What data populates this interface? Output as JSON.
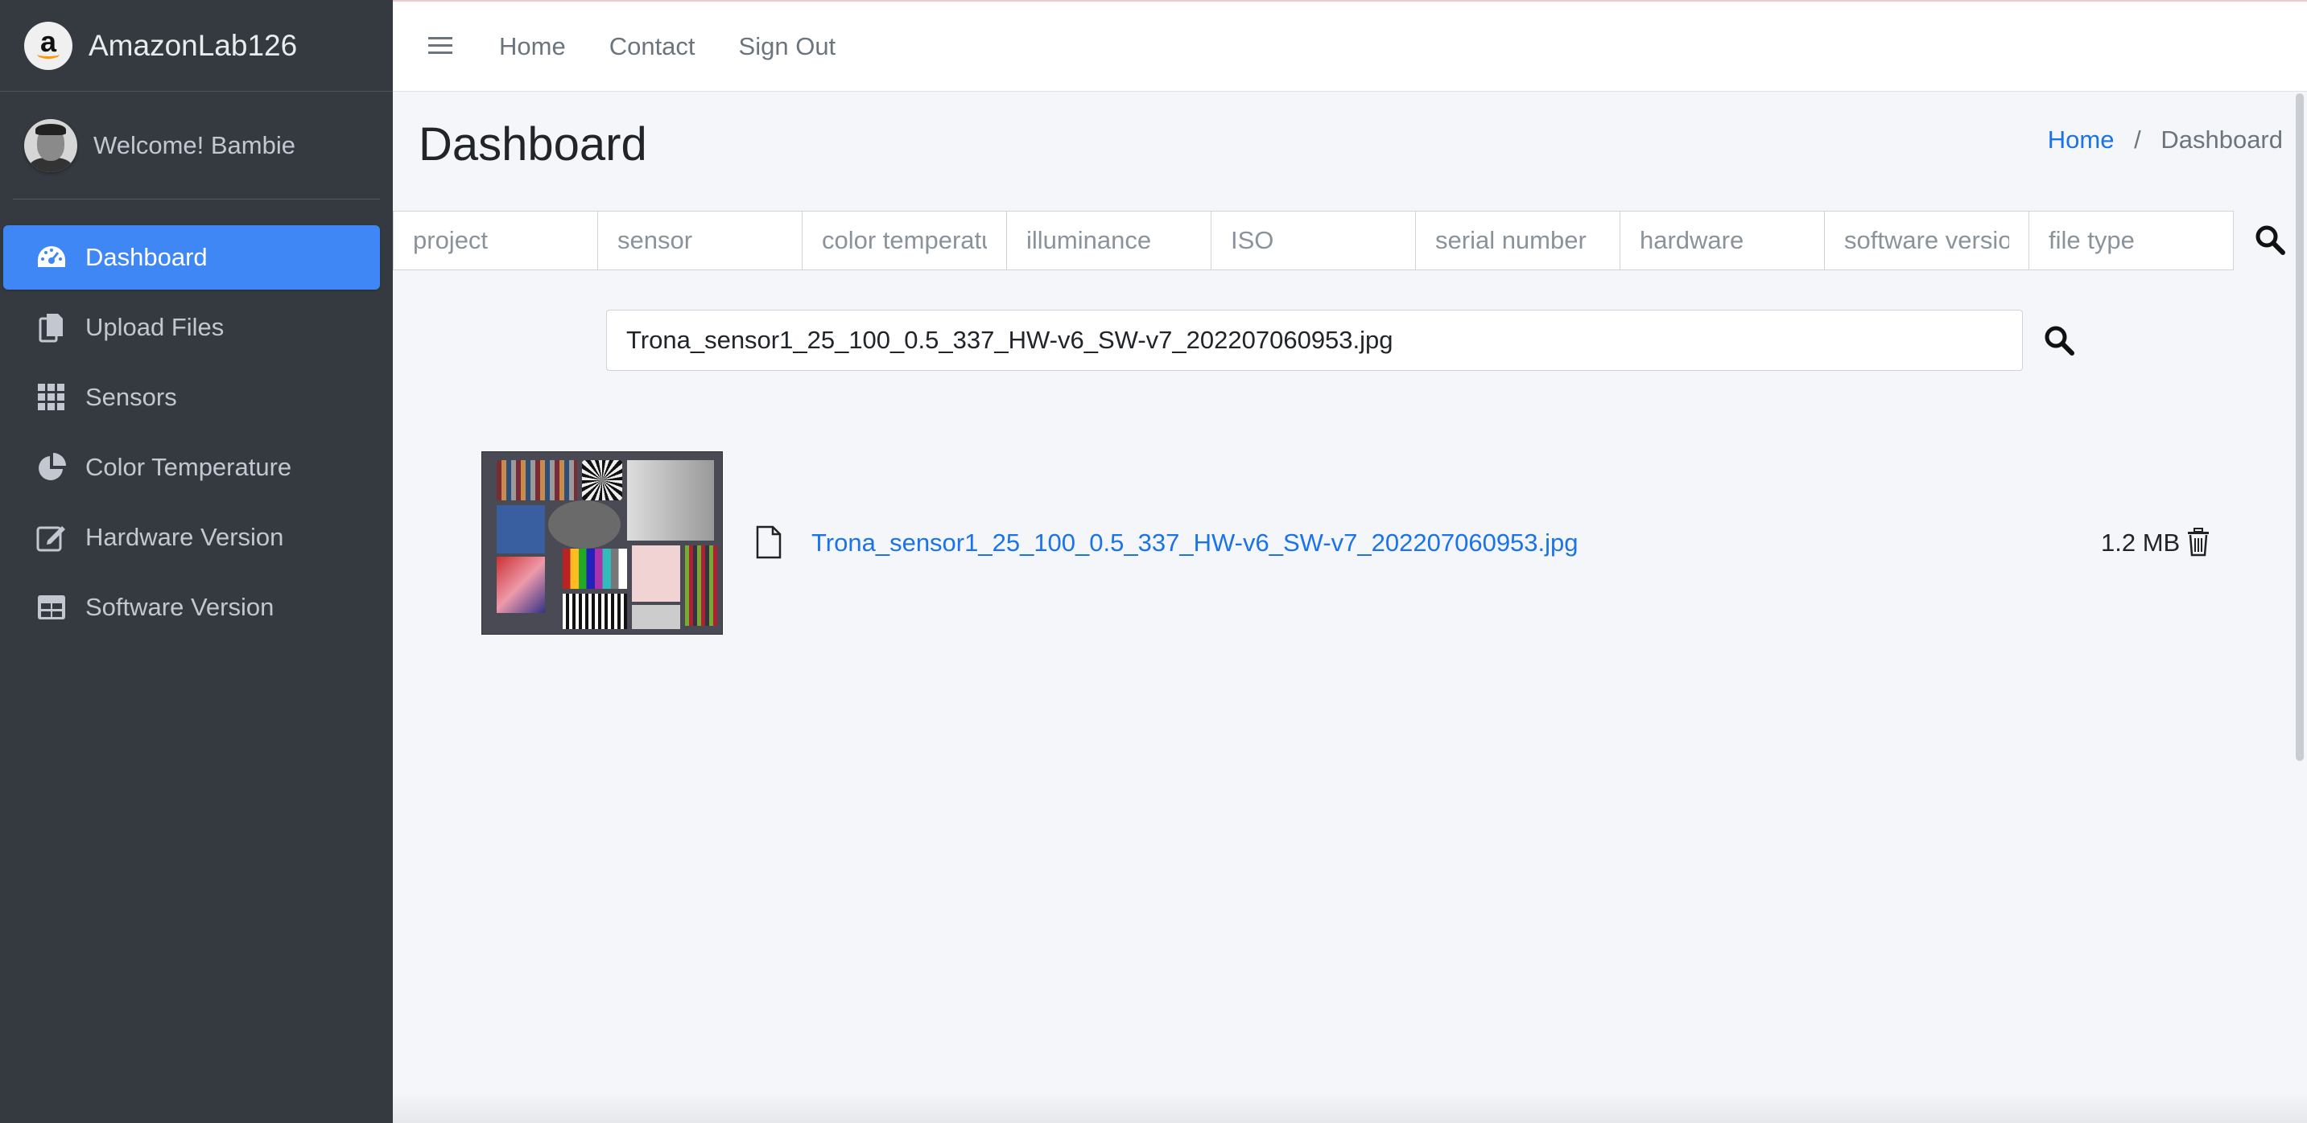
{
  "brand": {
    "name": "AmazonLab126",
    "logo_letter": "a"
  },
  "user": {
    "welcome": "Welcome! Bambie"
  },
  "sidebar": {
    "items": [
      {
        "label": "Dashboard",
        "icon": "dashboard-icon",
        "active": true
      },
      {
        "label": "Upload Files",
        "icon": "files-icon",
        "active": false
      },
      {
        "label": "Sensors",
        "icon": "grid-icon",
        "active": false
      },
      {
        "label": "Color Temperature",
        "icon": "pie-chart-icon",
        "active": false
      },
      {
        "label": "Hardware Version",
        "icon": "edit-icon",
        "active": false
      },
      {
        "label": "Software Version",
        "icon": "table-icon",
        "active": false
      }
    ]
  },
  "topbar": {
    "menu_icon": "hamburger-icon",
    "links": [
      "Home",
      "Contact",
      "Sign Out"
    ]
  },
  "page": {
    "title": "Dashboard",
    "breadcrumb": {
      "home": "Home",
      "separator": "/",
      "current": "Dashboard"
    }
  },
  "filters": {
    "placeholders": [
      "project",
      "sensor",
      "color temperature",
      "illuminance",
      "ISO",
      "serial number",
      "hardware",
      "software version",
      "file type"
    ]
  },
  "file_search": {
    "value": "Trona_sensor1_25_100_0.5_337_HW-v6_SW-v7_202207060953.jpg"
  },
  "result": {
    "filename": "Trona_sensor1_25_100_0.5_337_HW-v6_SW-v7_202207060953.jpg",
    "size": "1.2 MB"
  },
  "colors": {
    "sidebar_bg": "#343a40",
    "active_bg": "#3f87f5",
    "link": "#1a73e8",
    "content_bg": "#f4f6f9"
  }
}
